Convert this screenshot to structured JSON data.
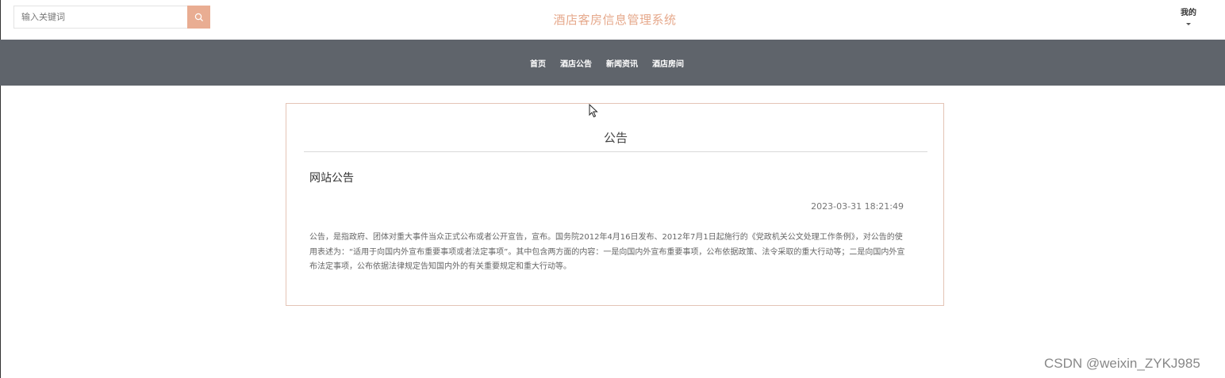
{
  "header": {
    "search": {
      "placeholder": "输入关键词",
      "value": ""
    },
    "search_icon": "search-icon",
    "site_title": "酒店客房信息管理系统",
    "user_menu_label": "我的"
  },
  "nav": {
    "items": [
      {
        "label": "首页"
      },
      {
        "label": "酒店公告"
      },
      {
        "label": "新闻资讯"
      },
      {
        "label": "酒店房间"
      }
    ]
  },
  "notice": {
    "section_title": "公告",
    "title": "网站公告",
    "date": "2023-03-31 18:21:49",
    "body": "公告，是指政府、团体对重大事件当众正式公布或者公开宣告，宣布。国务院2012年4月16日发布、2012年7月1日起施行的《党政机关公文处理工作条例》，对公告的使用表述为：“适用于向国内外宣布重要事项或者法定事项”。其中包含两方面的内容：一是向国内外宣布重要事项，公布依据政策、法令采取的重大行动等；二是向国内外宣布法定事项，公布依据法律规定告知国内外的有关重要规定和重大行动等。"
  },
  "watermark": "CSDN @weixin_ZYKJ985",
  "colors": {
    "accent": "#e9ad92",
    "title": "#e6a98c",
    "navbar": "#5f646b",
    "card_border": "#e4c4b6"
  }
}
